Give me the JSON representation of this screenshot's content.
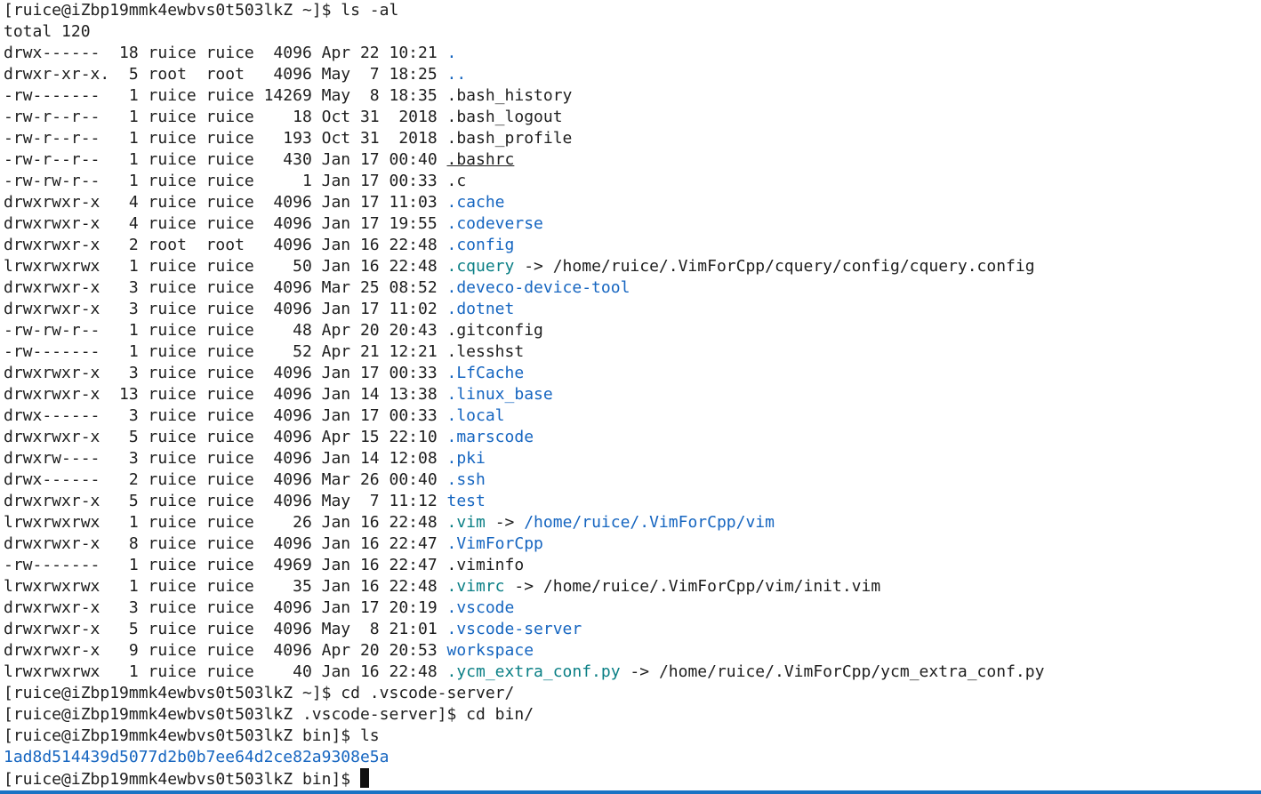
{
  "terminal": {
    "prompts": {
      "p1": "[ruice@iZbp19mmk4ewbvs0t503lkZ ~]$ ls -al",
      "p2": "[ruice@iZbp19mmk4ewbvs0t503lkZ ~]$ cd .vscode-server/",
      "p3": "[ruice@iZbp19mmk4ewbvs0t503lkZ .vscode-server]$ cd bin/",
      "p4": "[ruice@iZbp19mmk4ewbvs0t503lkZ bin]$ ls",
      "p5": "[ruice@iZbp19mmk4ewbvs0t503lkZ bin]$ "
    },
    "total": "total 120",
    "entries": [
      {
        "meta": "drwx------  18 ruice ruice  4096 Apr 22 10:21 ",
        "name": ".",
        "style": "blue"
      },
      {
        "meta": "drwxr-xr-x.  5 root  root   4096 May  7 18:25 ",
        "name": "..",
        "style": "blue"
      },
      {
        "meta": "-rw-------   1 ruice ruice 14269 May  8 18:35 ",
        "name": ".bash_history",
        "style": "plain"
      },
      {
        "meta": "-rw-r--r--   1 ruice ruice    18 Oct 31  2018 ",
        "name": ".bash_logout",
        "style": "plain"
      },
      {
        "meta": "-rw-r--r--   1 ruice ruice   193 Oct 31  2018 ",
        "name": ".bash_profile",
        "style": "plain"
      },
      {
        "meta": "-rw-r--r--   1 ruice ruice   430 Jan 17 00:40 ",
        "name": ".bashrc",
        "style": "underline"
      },
      {
        "meta": "-rw-rw-r--   1 ruice ruice     1 Jan 17 00:33 ",
        "name": ".c",
        "style": "plain"
      },
      {
        "meta": "drwxrwxr-x   4 ruice ruice  4096 Jan 17 11:03 ",
        "name": ".cache",
        "style": "blue"
      },
      {
        "meta": "drwxrwxr-x   4 ruice ruice  4096 Jan 17 19:55 ",
        "name": ".codeverse",
        "style": "blue"
      },
      {
        "meta": "drwxrwxr-x   2 root  root   4096 Jan 16 22:48 ",
        "name": ".config",
        "style": "blue"
      },
      {
        "meta": "lrwxrwxrwx   1 ruice ruice    50 Jan 16 22:48 ",
        "name": ".cquery",
        "style": "teal",
        "arrow": " -> ",
        "target": "/home/ruice/.VimForCpp/cquery/config/cquery.config",
        "target_style": "plain"
      },
      {
        "meta": "drwxrwxr-x   3 ruice ruice  4096 Mar 25 08:52 ",
        "name": ".deveco-device-tool",
        "style": "blue"
      },
      {
        "meta": "drwxrwxr-x   3 ruice ruice  4096 Jan 17 11:02 ",
        "name": ".dotnet",
        "style": "blue"
      },
      {
        "meta": "-rw-rw-r--   1 ruice ruice    48 Apr 20 20:43 ",
        "name": ".gitconfig",
        "style": "plain"
      },
      {
        "meta": "-rw-------   1 ruice ruice    52 Apr 21 12:21 ",
        "name": ".lesshst",
        "style": "plain"
      },
      {
        "meta": "drwxrwxr-x   3 ruice ruice  4096 Jan 17 00:33 ",
        "name": ".LfCache",
        "style": "blue"
      },
      {
        "meta": "drwxrwxr-x  13 ruice ruice  4096 Jan 14 13:38 ",
        "name": ".linux_base",
        "style": "blue"
      },
      {
        "meta": "drwx------   3 ruice ruice  4096 Jan 17 00:33 ",
        "name": ".local",
        "style": "blue"
      },
      {
        "meta": "drwxrwxr-x   5 ruice ruice  4096 Apr 15 22:10 ",
        "name": ".marscode",
        "style": "blue"
      },
      {
        "meta": "drwxrw----   3 ruice ruice  4096 Jan 14 12:08 ",
        "name": ".pki",
        "style": "blue"
      },
      {
        "meta": "drwx------   2 ruice ruice  4096 Mar 26 00:40 ",
        "name": ".ssh",
        "style": "blue"
      },
      {
        "meta": "drwxrwxr-x   5 ruice ruice  4096 May  7 11:12 ",
        "name": "test",
        "style": "blue"
      },
      {
        "meta": "lrwxrwxrwx   1 ruice ruice    26 Jan 16 22:48 ",
        "name": ".vim",
        "style": "teal",
        "arrow": " -> ",
        "target": "/home/ruice/.VimForCpp/vim",
        "target_style": "blue"
      },
      {
        "meta": "drwxrwxr-x   8 ruice ruice  4096 Jan 16 22:47 ",
        "name": ".VimForCpp",
        "style": "blue"
      },
      {
        "meta": "-rw-------   1 ruice ruice  4969 Jan 16 22:47 ",
        "name": ".viminfo",
        "style": "plain"
      },
      {
        "meta": "lrwxrwxrwx   1 ruice ruice    35 Jan 16 22:48 ",
        "name": ".vimrc",
        "style": "teal",
        "arrow": " -> ",
        "target": "/home/ruice/.VimForCpp/vim/init.vim",
        "target_style": "plain"
      },
      {
        "meta": "drwxrwxr-x   3 ruice ruice  4096 Jan 17 20:19 ",
        "name": ".vscode",
        "style": "blue"
      },
      {
        "meta": "drwxrwxr-x   5 ruice ruice  4096 May  8 21:01 ",
        "name": ".vscode-server",
        "style": "blue"
      },
      {
        "meta": "drwxrwxr-x   9 ruice ruice  4096 Apr 20 20:53 ",
        "name": "workspace",
        "style": "blue"
      },
      {
        "meta": "lrwxrwxrwx   1 ruice ruice    40 Jan 16 22:48 ",
        "name": ".ycm_extra_conf.py",
        "style": "teal",
        "arrow": " -> ",
        "target": "/home/ruice/.VimForCpp/ycm_extra_conf.py",
        "target_style": "plain"
      }
    ],
    "bin_listing": "1ad8d514439d5077d2b0b7ee64d2ce82a9308e5a"
  },
  "colors": {
    "background": "#ffffff",
    "text": "#1e1e1e",
    "directory": "#1565c0",
    "symlink": "#0a7f85",
    "bottom_bar": "#1a73c4"
  }
}
